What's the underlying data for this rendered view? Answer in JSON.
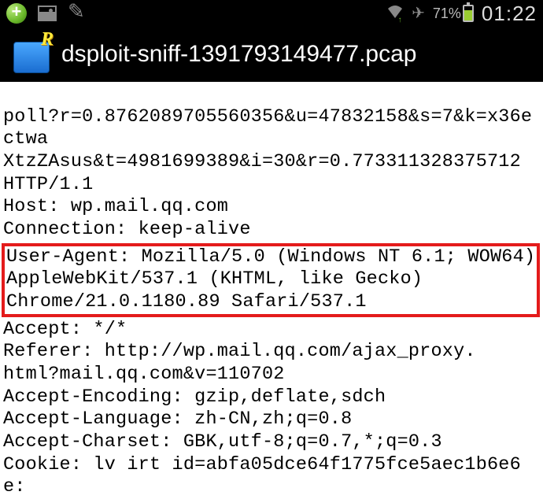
{
  "status": {
    "battery_pct": "71%",
    "clock": "01:22"
  },
  "title": {
    "filename": "dsploit-sniff-1391793149477.pcap"
  },
  "http": {
    "line1": "poll?r=0.8762089705560356&u=47832158&s=7&k=x36ectwa",
    "line2": "XtzZAsus&t=4981699389&i=30&r=0.773311328375712",
    "line3": "HTTP/1.1",
    "host": "Host: wp.mail.qq.com",
    "connection": "Connection: keep-alive",
    "ua1": "User-Agent: Mozilla/5.0 (Windows NT 6.1; WOW64)",
    "ua2": "AppleWebKit/537.1 (KHTML, like Gecko)",
    "ua3": "Chrome/21.0.1180.89 Safari/537.1",
    "accept": "Accept: */*",
    "referer1": "Referer: http://wp.mail.qq.com/ajax_proxy.",
    "referer2": "html?mail.qq.com&v=110702",
    "accept_encoding": "Accept-Encoding: gzip,deflate,sdch",
    "accept_language": "Accept-Language: zh-CN,zh;q=0.8",
    "accept_charset": "Accept-Charset: GBK,utf-8;q=0.7,*;q=0.3",
    "cookie": "Cookie: lv irt id=abfa05dce64f1775fce5aec1b6e6e:"
  }
}
